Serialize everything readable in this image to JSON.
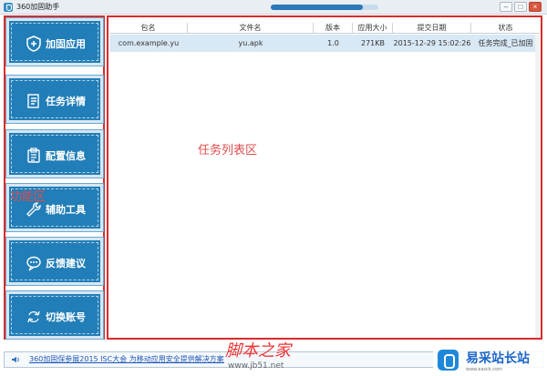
{
  "window": {
    "title": "360加固助手",
    "progress_percent": 86
  },
  "sidebar": {
    "items": [
      {
        "label": "加固应用",
        "icon": "shield-plus-icon"
      },
      {
        "label": "任务详情",
        "icon": "task-details-icon"
      },
      {
        "label": "配置信息",
        "icon": "clipboard-icon"
      },
      {
        "label": "辅助工具",
        "icon": "wrench-icon"
      },
      {
        "label": "反馈建议",
        "icon": "chat-bubble-icon"
      },
      {
        "label": "切换账号",
        "icon": "switch-account-icon"
      }
    ]
  },
  "annotations": {
    "function_area": "功能区",
    "task_list_area": "任务列表区"
  },
  "table": {
    "columns": [
      "包名",
      "文件名",
      "版本",
      "应用大小",
      "提交日期",
      "状态"
    ],
    "rows": [
      [
        "com.example.yu",
        "yu.apk",
        "1.0",
        "271KB",
        "2015-12-29 15:02:26",
        "任务完成_已加固"
      ]
    ]
  },
  "status": {
    "notice": "360加固保参展2015 ISC大会 为移动应用安全提供解决方案"
  },
  "watermarks": {
    "site_cn": "脚本之家",
    "site_en": "www.jb51.net",
    "logo_cn": "易采站长站",
    "logo_en": "www.easck.com"
  },
  "colors": {
    "accent": "#217eb8",
    "highlight_border": "#d92b2b",
    "selected_row": "#d8e8f5"
  }
}
